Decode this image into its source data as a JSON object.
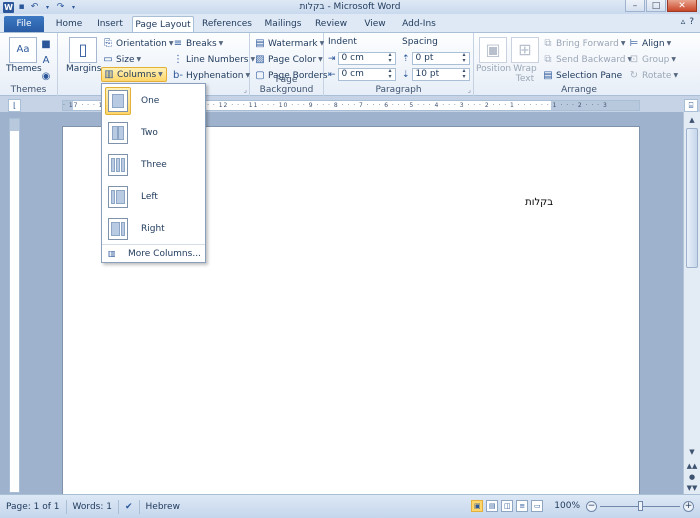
{
  "window": {
    "title": "בקלות  -  Microsoft Word",
    "app_icon": "W"
  },
  "tabs": [
    {
      "label": "File"
    },
    {
      "label": "Home"
    },
    {
      "label": "Insert"
    },
    {
      "label": "Page Layout"
    },
    {
      "label": "References"
    },
    {
      "label": "Mailings"
    },
    {
      "label": "Review"
    },
    {
      "label": "View"
    },
    {
      "label": "Add-Ins"
    }
  ],
  "ribbon": {
    "themes": {
      "themes_label": "Themes",
      "group_label": "Themes"
    },
    "page_setup": {
      "margins": "Margins",
      "orientation": "Orientation",
      "size": "Size",
      "columns": "Columns",
      "breaks": "Breaks",
      "line_numbers": "Line Numbers",
      "hyphenation": "Hyphenation"
    },
    "page_background": {
      "watermark": "Watermark",
      "page_color": "Page Color",
      "page_borders": "Page Borders",
      "group_label": "Page Background"
    },
    "paragraph": {
      "indent_label": "Indent",
      "spacing_label": "Spacing",
      "indent_left": "0 cm",
      "indent_right": "0 cm",
      "spacing_before": "0 pt",
      "spacing_after": "10 pt",
      "group_label": "Paragraph"
    },
    "arrange": {
      "position": "Position",
      "wrap_text_1": "Wrap",
      "wrap_text_2": "Text",
      "bring_forward": "Bring Forward",
      "send_backward": "Send Backward",
      "selection_pane": "Selection Pane",
      "align": "Align",
      "group": "Group",
      "rotate": "Rotate",
      "group_label": "Arrange"
    }
  },
  "ruler": {
    "ticks": "· 17 · · · 16 · · · 15 · · · 14 · · · 13 · · · 12 · · · 11 · · · 10 · · · 9 · · · 8 · · · 7 · · · 6 · · · 5 · · · 4 · · · 3 · · · 2 · · · 1 · · · · · · 1 · · · 2 · · · 3"
  },
  "document": {
    "text": "בקלות"
  },
  "columns_menu": {
    "items": [
      {
        "label": "One"
      },
      {
        "label": "Two"
      },
      {
        "label": "Three"
      },
      {
        "label": "Left"
      },
      {
        "label": "Right"
      }
    ],
    "more": "More Columns..."
  },
  "statusbar": {
    "page": "Page: 1 of 1",
    "words": "Words: 1",
    "language": "Hebrew",
    "zoom": "100%",
    "zoom_level_percent": 100
  }
}
